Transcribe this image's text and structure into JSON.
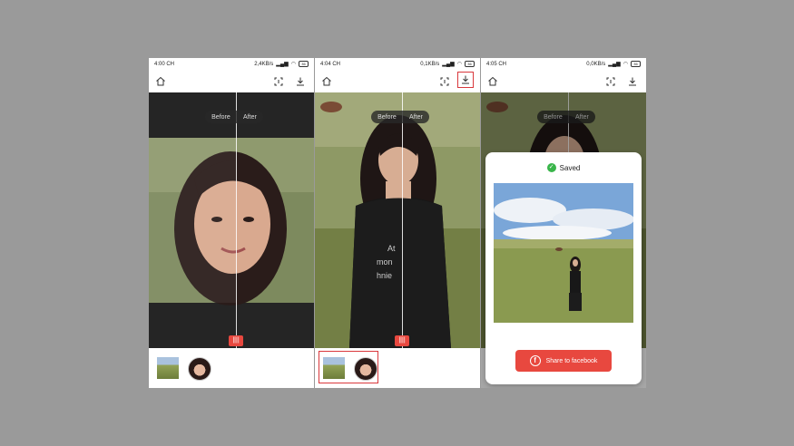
{
  "screens": [
    {
      "time": "4:00 CH",
      "speed": "2,4KB/s"
    },
    {
      "time": "4:04 CH",
      "speed": "0,1KB/s"
    },
    {
      "time": "4:05 CH",
      "speed": "0,0KB/s"
    }
  ],
  "battery": "36",
  "compare": {
    "before": "Before",
    "after": "After"
  },
  "dialog": {
    "saved": "Saved",
    "share": "Share to facebook"
  },
  "colors": {
    "accent": "#e8483f",
    "highlight": "#d9383c",
    "success": "#39b54a"
  }
}
